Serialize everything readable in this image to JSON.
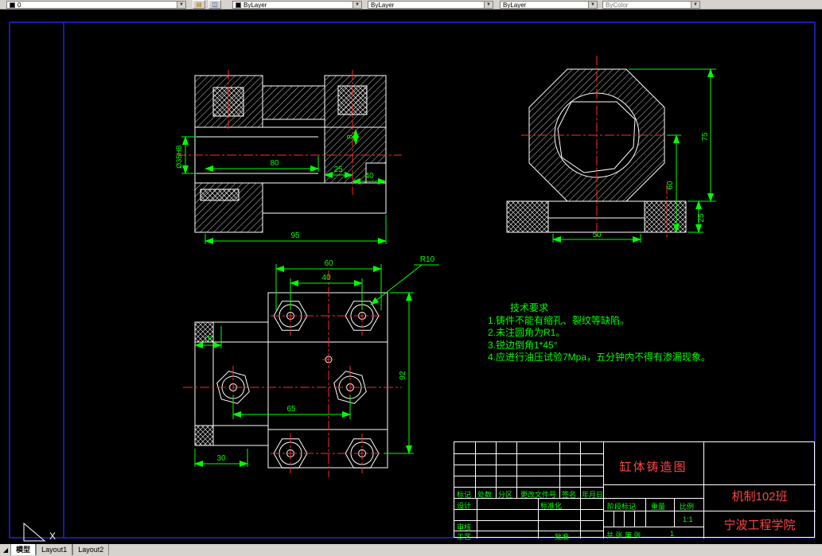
{
  "toolbar": {
    "layer_value": "0",
    "color_value": "ByLayer",
    "linetype_value": "ByLayer",
    "lineweight_value": "ByLayer",
    "plotstyle_value": "ByColor"
  },
  "drawing": {
    "front_section": {
      "d95": "95",
      "d80": "80",
      "d25": "25",
      "d40": "40",
      "d8": "8",
      "dbore": "Ø35HB"
    },
    "side_view": {
      "d75": "75",
      "d60": "60",
      "d25": "25",
      "d50": "50"
    },
    "top_view": {
      "d60": "60",
      "d40": "40",
      "r10": "R10",
      "d15": "15",
      "d92": "92",
      "d65": "65",
      "d30": "30"
    }
  },
  "tech_req": {
    "title": "技术要求",
    "lines": [
      "1.铸件不能有缩孔、裂纹等缺陷。",
      "2.未注圆角为R1。",
      "3.锐边倒角1*45°",
      "4.应进行油压试验7Mpa，五分钟内不得有渗漏现象。"
    ]
  },
  "title_block": {
    "drawing_title": "缸体铸造图",
    "class_name": "机制102班",
    "school": "宁波工程学院",
    "col_labels": [
      "标记",
      "处数",
      "分区",
      "更改文件号",
      "签名",
      "年月日"
    ],
    "design": "设计",
    "standardize": "标准化",
    "review": "审核",
    "process": "工艺",
    "approve": "批准",
    "stage_label": "阶段标记",
    "weight_label": "重量",
    "scale_label": "比例",
    "scale_value": "1:1",
    "sheet_info": "共 张 第 张",
    "sheet_no": "1"
  },
  "status": {
    "model_tab": "模型",
    "layout1_tab": "Layout1",
    "layout2_tab": "Layout2",
    "ucs_x": "X"
  }
}
